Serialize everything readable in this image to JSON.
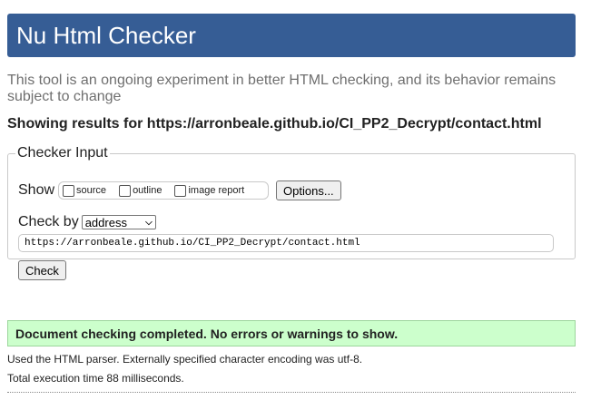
{
  "header": {
    "title": "Nu Html Checker",
    "color": "#365d95"
  },
  "intro": "This tool is an ongoing experiment in better HTML checking, and its behavior remains subject to change",
  "showing": "Showing results for https://arronbeale.github.io/CI_PP2_Decrypt/contact.html",
  "checker": {
    "legend": "Checker Input",
    "show_label": "Show",
    "options": [
      {
        "label": "source",
        "checked": false
      },
      {
        "label": "outline",
        "checked": false
      },
      {
        "label": "image report",
        "checked": false
      }
    ],
    "options_button": "Options...",
    "check_by_label": "Check by",
    "check_by_value": "address",
    "url": "https://arronbeale.github.io/CI_PP2_Decrypt/contact.html",
    "check_button": "Check"
  },
  "result": {
    "message": "Document checking completed. No errors or warnings to show.",
    "color": "#ccffcc"
  },
  "footer": {
    "parser_note": "Used the HTML parser. Externally specified character encoding was utf-8.",
    "execution_time": "Total execution time 88 milliseconds."
  }
}
